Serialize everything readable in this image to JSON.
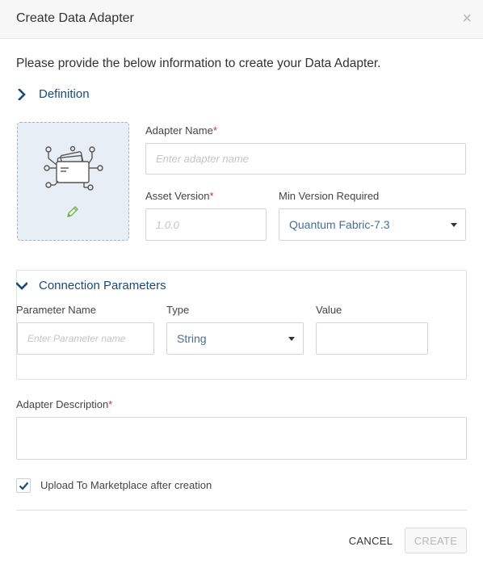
{
  "dialog": {
    "title": "Create Data Adapter",
    "close_symbol": "×"
  },
  "intro_text": "Please provide the below information to create your Data Adapter.",
  "definition": {
    "heading": "Definition",
    "icon_name": "adapter-icon",
    "edit_icon_name": "pencil-icon",
    "adapter_name": {
      "label": "Adapter Name",
      "required_mark": "*",
      "placeholder": "Enter adapter name",
      "value": ""
    },
    "asset_version": {
      "label": "Asset Version",
      "required_mark": "*",
      "placeholder": "1.0.0",
      "value": ""
    },
    "min_version": {
      "label": "Min Version Required",
      "selected": "Quantum Fabric-7.3"
    }
  },
  "connection_parameters": {
    "heading": "Connection Parameters",
    "columns": [
      "Parameter Name",
      "Type",
      "Value"
    ],
    "rows": [
      {
        "name_placeholder": "Enter Parameter name",
        "name_value": "",
        "type": "String",
        "value": ""
      }
    ]
  },
  "description": {
    "label": "Adapter Description",
    "required_mark": "*",
    "value": ""
  },
  "upload": {
    "label": "Upload To Marketplace after creation",
    "checked": true
  },
  "footer": {
    "cancel_label": "CANCEL",
    "create_label": "CREATE"
  },
  "colors": {
    "accent": "#1a4a7a",
    "required": "#c0392b",
    "icon_bg": "#e8eef6",
    "pencil": "#6ab04c"
  }
}
